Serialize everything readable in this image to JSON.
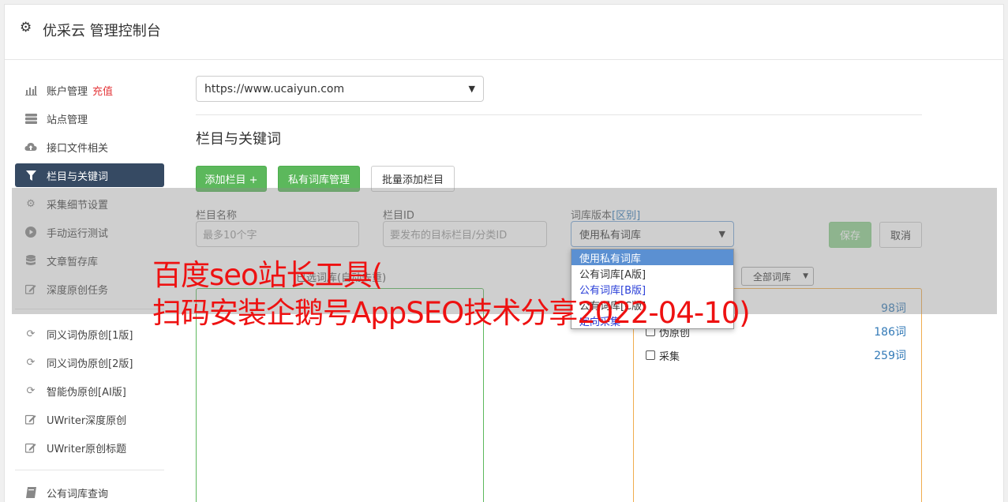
{
  "app": {
    "title": "优采云 管理控制台",
    "gear_icon": "gear-icon"
  },
  "sidebar": {
    "items": [
      {
        "label": "账户管理",
        "badge": "充值",
        "icon": "bar-chart-icon"
      },
      {
        "label": "站点管理",
        "icon": "server-icon"
      },
      {
        "label": "接口文件相关",
        "icon": "cloud-upload-icon"
      },
      {
        "label": "栏目与关键词",
        "icon": "filter-icon",
        "active": true
      },
      {
        "label": "采集细节设置",
        "icon": "cogs-icon"
      },
      {
        "label": "手动运行测试",
        "icon": "play-circle-icon"
      },
      {
        "label": "文章暂存库",
        "icon": "database-icon"
      },
      {
        "label": "深度原创任务",
        "icon": "edit-icon"
      },
      {
        "label": "同义词伪原创[1版]",
        "icon": "refresh-icon"
      },
      {
        "label": "同义词伪原创[2版]",
        "icon": "refresh-icon"
      },
      {
        "label": "智能伪原创[AI版]",
        "icon": "refresh-icon"
      },
      {
        "label": "UWriter深度原创",
        "icon": "edit-icon"
      },
      {
        "label": "UWriter原创标题",
        "icon": "edit-icon"
      },
      {
        "label": "公有词库查询",
        "icon": "book-icon"
      }
    ]
  },
  "main": {
    "site_select": "https://www.ucaiyun.com",
    "section_title": "栏目与关键词",
    "buttons": {
      "add_column": "添加栏目 +",
      "private_lib": "私有词库管理",
      "batch_add": "批量添加栏目"
    },
    "form": {
      "name_label": "栏目名称",
      "name_placeholder": "最多10个字",
      "id_label": "栏目ID",
      "id_placeholder": "要发布的目标栏目/分类ID",
      "version_label": "词库版本",
      "version_link": "[区别]",
      "version_value": "使用私有词库",
      "save": "保存",
      "cancel": "取消"
    },
    "selected_label": "已选词库(自动去重)",
    "filter_select": "全部词库",
    "libraries": [
      {
        "name": "",
        "count": "98词"
      },
      {
        "name": "伪原创",
        "count": "186词"
      },
      {
        "name": "采集",
        "count": "259词"
      }
    ],
    "dropdown_options": [
      {
        "label": "使用私有词库",
        "state": "selected"
      },
      {
        "label": "公有词库[A版]",
        "state": "normal"
      },
      {
        "label": "公有词库[B版]",
        "state": "blue"
      },
      {
        "label": "公有词库[C版]",
        "state": "normal"
      },
      {
        "label": "定向采集",
        "state": "blue"
      }
    ]
  },
  "watermark": {
    "line1": "百度seo站长工具(",
    "line2": "扫码安装企鹅号AppSEO技术分享2022-04-10)"
  },
  "colors": {
    "accent": "#364a63",
    "green": "#5cb85c",
    "orange": "#f0ad4e",
    "watermark": "#ee1111"
  }
}
